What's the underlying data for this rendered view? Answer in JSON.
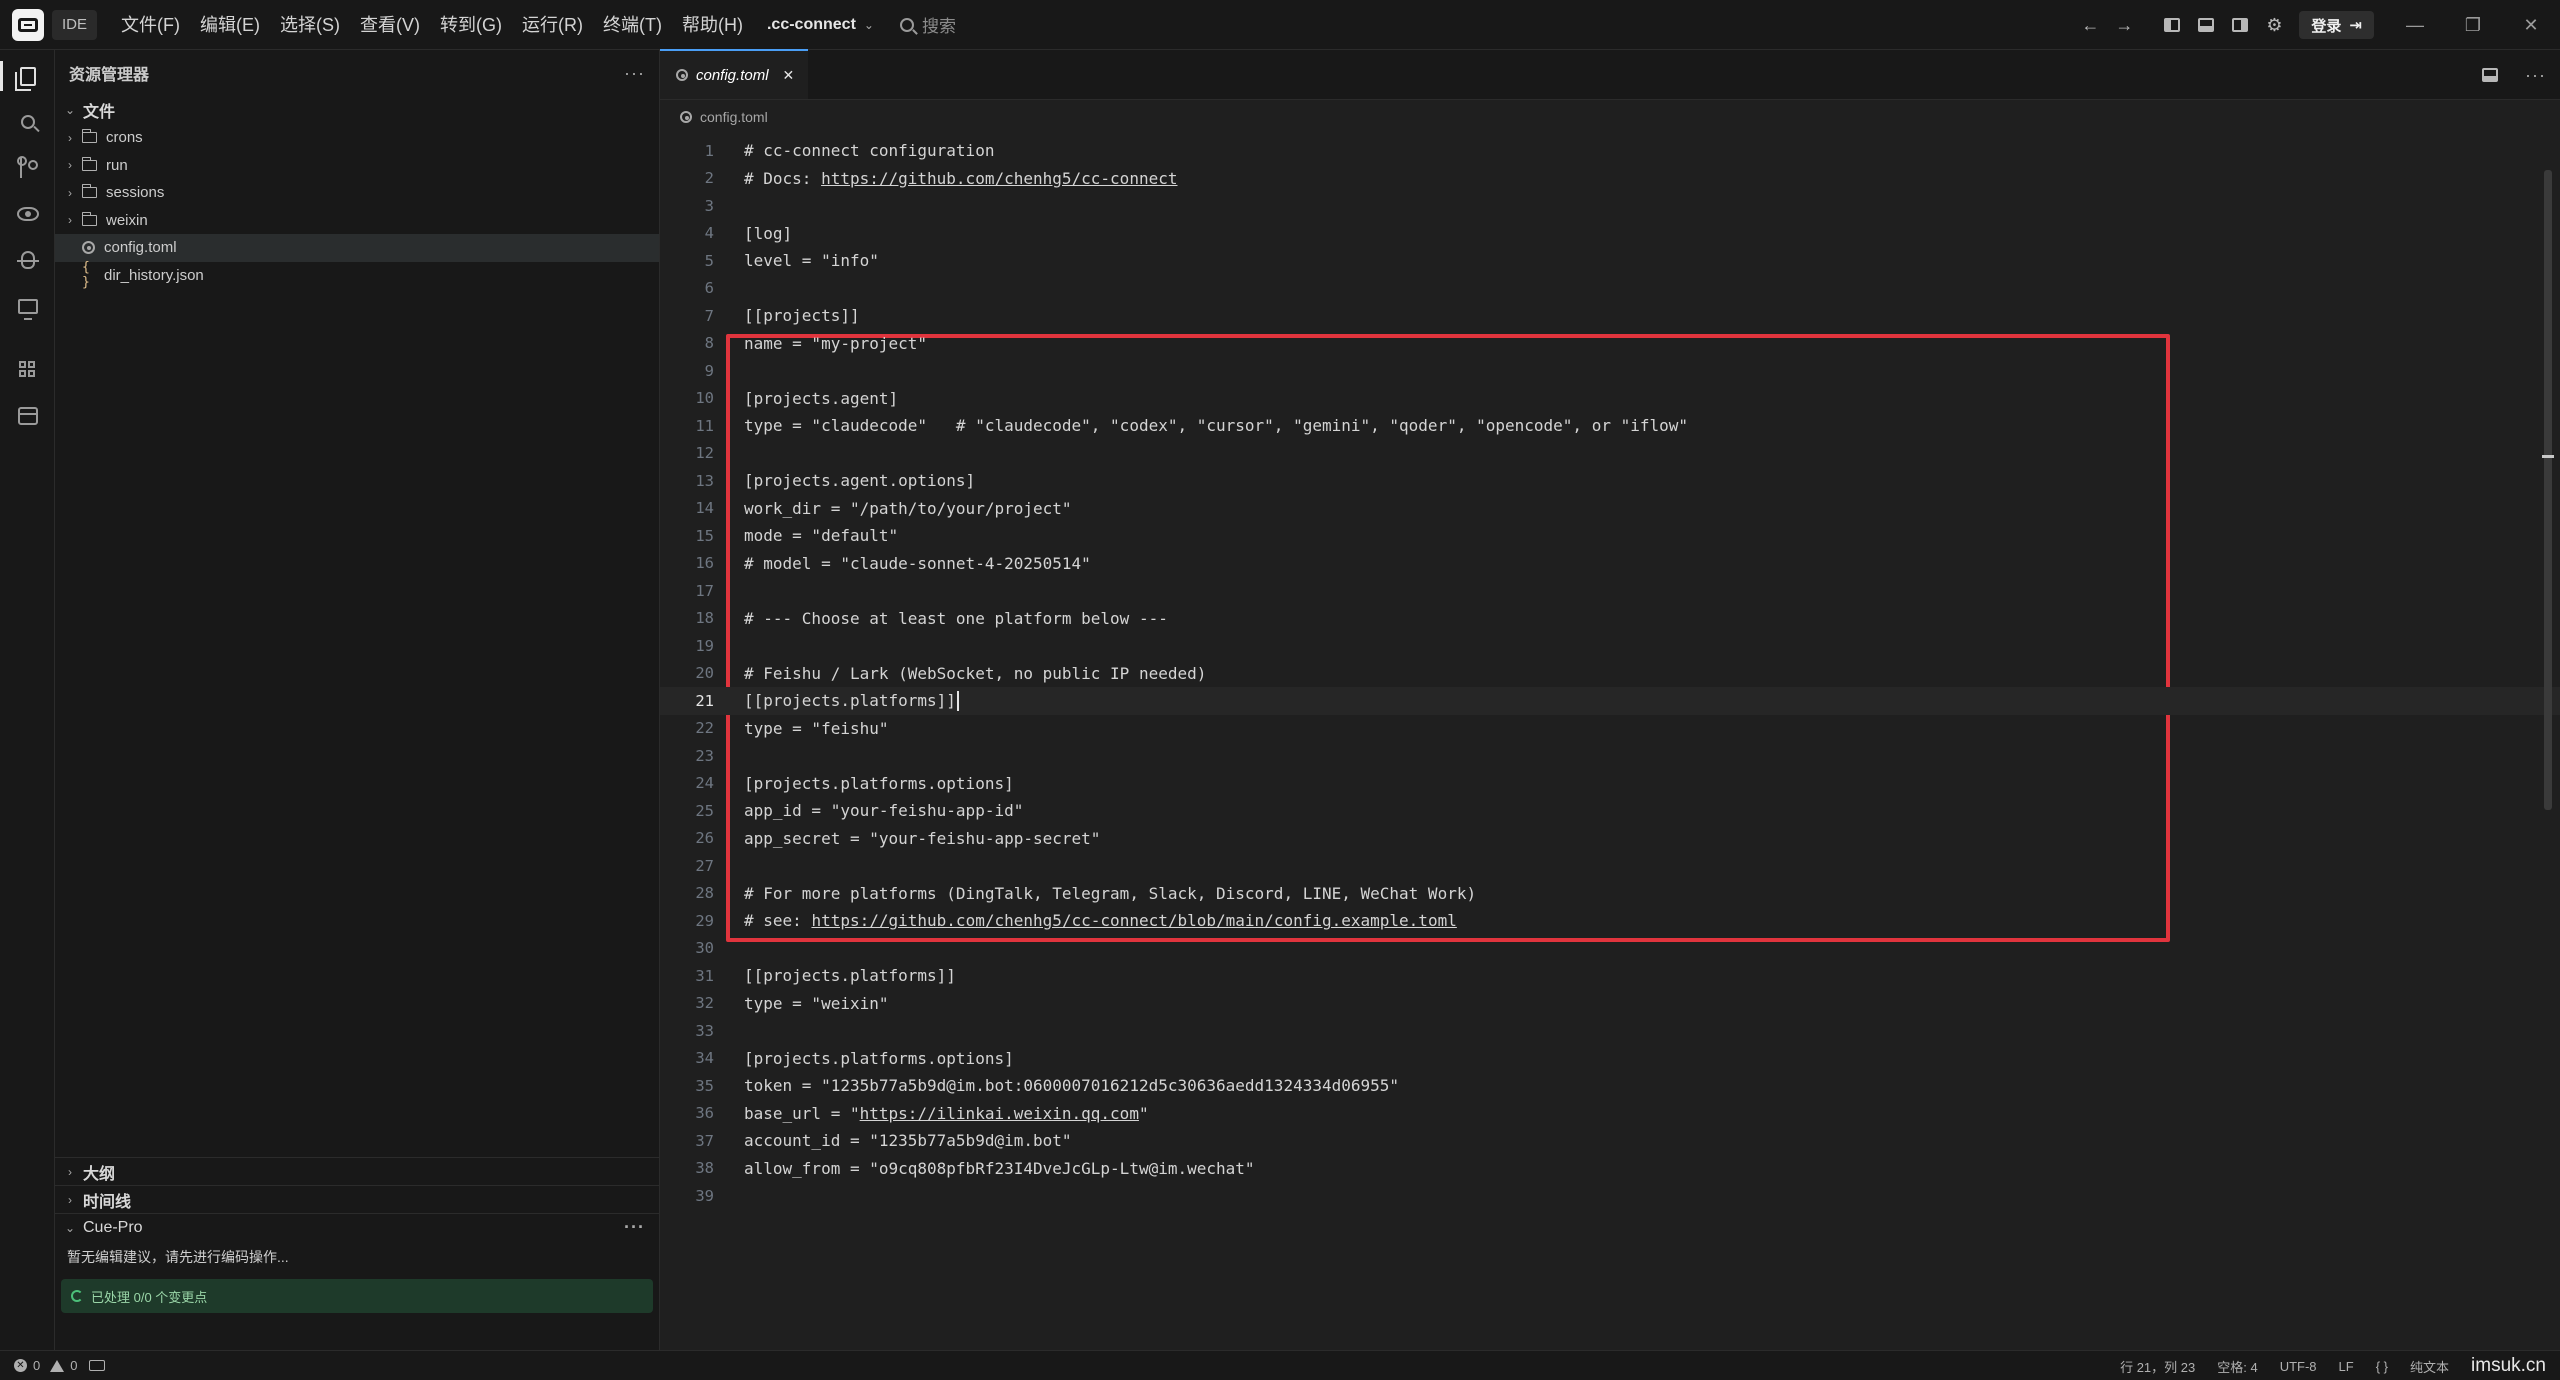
{
  "titlebar": {
    "ide_badge": "IDE",
    "menus": [
      "文件(F)",
      "编辑(E)",
      "选择(S)",
      "查看(V)",
      "转到(G)",
      "运行(R)",
      "终端(T)",
      "帮助(H)"
    ],
    "project": ".cc-connect",
    "search_placeholder": "搜索",
    "login_label": "登录"
  },
  "sidebar": {
    "title": "资源管理器",
    "root_label": "文件",
    "items": [
      {
        "type": "folder",
        "label": "crons"
      },
      {
        "type": "folder",
        "label": "run"
      },
      {
        "type": "folder",
        "label": "sessions"
      },
      {
        "type": "folder",
        "label": "weixin"
      },
      {
        "type": "file-gear",
        "label": "config.toml"
      },
      {
        "type": "file-json",
        "label": "dir_history.json"
      }
    ],
    "json_icon": "{ }",
    "outline_label": "大纲",
    "timeline_label": "时间线",
    "cue_label": "Cue-Pro",
    "cue_message": "暂无编辑建议，请先进行编码操作...",
    "cue_status": "已处理 0/0 个变更点"
  },
  "editor": {
    "tab_label": "config.toml",
    "breadcrumb": "config.toml",
    "current_line": 21,
    "lines": [
      "# cc-connect configuration",
      "# Docs: https://github.com/chenhg5/cc-connect",
      "",
      "[log]",
      "level = \"info\"",
      "",
      "[[projects]]",
      "name = \"my-project\"",
      "",
      "[projects.agent]",
      "type = \"claudecode\"   # \"claudecode\", \"codex\", \"cursor\", \"gemini\", \"qoder\", \"opencode\", or \"iflow\"",
      "",
      "[projects.agent.options]",
      "work_dir = \"/path/to/your/project\"",
      "mode = \"default\"",
      "# model = \"claude-sonnet-4-20250514\"",
      "",
      "# --- Choose at least one platform below ---",
      "",
      "# Feishu / Lark (WebSocket, no public IP needed)",
      "[[projects.platforms]]",
      "type = \"feishu\"",
      "",
      "[projects.platforms.options]",
      "app_id = \"your-feishu-app-id\"",
      "app_secret = \"your-feishu-app-secret\"",
      "",
      "# For more platforms (DingTalk, Telegram, Slack, Discord, LINE, WeChat Work)",
      "# see: https://github.com/chenhg5/cc-connect/blob/main/config.example.toml",
      "",
      "[[projects.platforms]]",
      "type = \"weixin\"",
      "",
      "[projects.platforms.options]",
      "token = \"1235b77a5b9d@im.bot:0600007016212d5c30636aedd1324334d06955\"",
      "base_url = \"https://ilinkai.weixin.qq.com\"",
      "account_id = \"1235b77a5b9d@im.bot\"",
      "allow_from = \"o9cq808pfbRf23I4DveJcGLp-Ltw@im.wechat\"",
      ""
    ]
  },
  "statusbar": {
    "errors": "0",
    "warnings": "0",
    "position": "行 21，列 23",
    "spaces": "空格: 4",
    "encoding": "UTF-8",
    "eol": "LF",
    "lang_icon": "{ }",
    "language": "纯文本",
    "watermark": "imsuk.cn"
  },
  "colors": {
    "accent": "#4a9ef5",
    "highlight_box": "#e0343d",
    "background": "#1f1f1f",
    "sidebar": "#181818"
  }
}
